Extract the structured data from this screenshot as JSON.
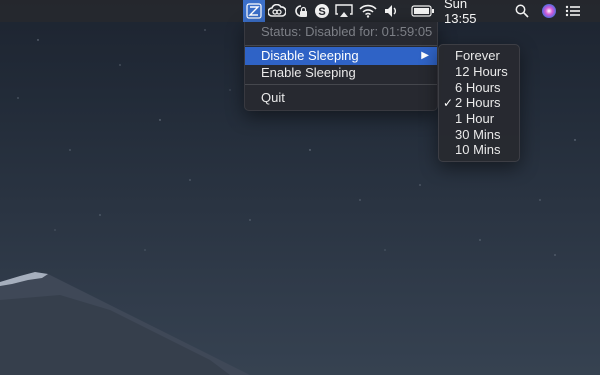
{
  "menubar": {
    "clock": "Sun 13:55",
    "icons": [
      "amphetamine-icon",
      "creative-cloud-icon",
      "lock-sync-icon",
      "skype-icon",
      "airplay-icon",
      "wifi-icon",
      "volume-icon",
      "battery-icon",
      "search-icon",
      "siri-icon",
      "notification-list-icon"
    ]
  },
  "menu": {
    "status": "Status: Disabled for: 01:59:05",
    "items": [
      {
        "label": "Disable Sleeping",
        "has_submenu": true,
        "highlighted": true
      },
      {
        "label": "Enable Sleeping"
      },
      {
        "label": "Quit"
      }
    ],
    "submenu_arrow": "▶"
  },
  "submenu": {
    "check_mark": "✓",
    "items": [
      {
        "label": "Forever"
      },
      {
        "label": "12 Hours"
      },
      {
        "label": "6 Hours"
      },
      {
        "label": "2 Hours",
        "checked": true
      },
      {
        "label": "1 Hour"
      },
      {
        "label": "30 Mins"
      },
      {
        "label": "10 Mins"
      }
    ]
  },
  "colors": {
    "highlight": "#2f63c6",
    "menu_bg": "#282a30",
    "sky_top": "#1d2430",
    "mountain": "#3f4857"
  }
}
